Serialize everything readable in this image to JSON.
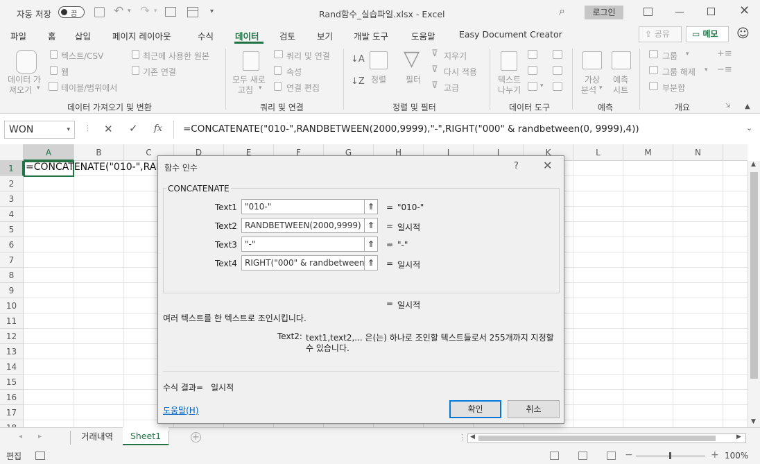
{
  "title_bar": {
    "autosave_label": "자동 저장",
    "autosave_state": "끔",
    "doc_title": "Rand함수_실습파일.xlsx  -  Excel",
    "login_label": "로그인"
  },
  "menu": {
    "tabs": [
      "파일",
      "홈",
      "삽입",
      "페이지 레이아웃",
      "수식",
      "데이터",
      "검토",
      "보기",
      "개발 도구",
      "도움말",
      "Easy Document Creator"
    ],
    "share_label": "공유",
    "memo_label": "메모"
  },
  "ribbon": {
    "get_data": {
      "big_label_1": "데이터 가",
      "big_label_2": "져오기",
      "text_csv": "텍스트/CSV",
      "web": "웹",
      "table_range": "테이블/범위에서",
      "recent_sources": "최근에 사용한 원본",
      "existing_conn": "기존 연결",
      "group": "데이터 가져오기 및 변환"
    },
    "queries": {
      "refresh_1": "모두 새로",
      "refresh_2": "고침",
      "queries_conn": "쿼리 및 연결",
      "properties": "속성",
      "edit_links": "연결 편집",
      "group": "쿼리 및 연결"
    },
    "sort_filter": {
      "sort": "정렬",
      "filter": "필터",
      "clear": "지우기",
      "reapply": "다시 적용",
      "advanced": "고급",
      "group": "정렬 및 필터"
    },
    "data_tools": {
      "text_col_1": "텍스트",
      "text_col_2": "나누기",
      "group": "데이터 도구"
    },
    "forecast": {
      "whatif_1": "가상",
      "whatif_2": "분석",
      "sheet_1": "예측",
      "sheet_2": "시트",
      "group": "예측"
    },
    "outline": {
      "group_btn": "그룹",
      "ungroup_btn": "그룹 해제",
      "subtotal": "부분합",
      "group": "개요"
    }
  },
  "formula_bar": {
    "name_box": "WON",
    "fx": "fx",
    "formula": "=CONCATENATE(\"010-\",RANDBETWEEN(2000,9999),\"-\",RIGHT(\"000\" & randbetween(0, 9999),4))"
  },
  "grid": {
    "columns": [
      "A",
      "B",
      "C",
      "D",
      "E",
      "F",
      "G",
      "H",
      "I",
      "J",
      "K",
      "L",
      "M",
      "N"
    ],
    "rows": [
      "1",
      "2",
      "3",
      "4",
      "5",
      "6",
      "7",
      "8",
      "9",
      "10",
      "11",
      "12",
      "13",
      "14",
      "15",
      "16",
      "17",
      "18"
    ],
    "cell_a1": "=CONCATENATE(\"010-\",RAN"
  },
  "sheets": {
    "tabs": [
      "거래내역",
      "Sheet1"
    ],
    "active": "Sheet1"
  },
  "status_bar": {
    "mode": "편집",
    "zoom": "100%"
  },
  "dialog": {
    "title": "함수 인수",
    "help": "?",
    "function_name": "CONCATENATE",
    "args": [
      {
        "label": "Text1",
        "value": "\"010-\"",
        "result": "\"010-\""
      },
      {
        "label": "Text2",
        "value": "RANDBETWEEN(2000,9999)",
        "result": "일시적"
      },
      {
        "label": "Text3",
        "value": "\"-\"",
        "result": "\"-\""
      },
      {
        "label": "Text4",
        "value": "RIGHT(\"000\" & randbetween(0",
        "result": "일시적"
      }
    ],
    "overall_result": "일시적",
    "description": "여러 텍스트를 한 텍스트로 조인시킵니다.",
    "arg_help_name": "Text2:",
    "arg_help_text_1": "text1,text2,... 은(는) 하나로 조인할 텍스트들로서 255개까지 지정할",
    "arg_help_text_2": "수 있습니다.",
    "formula_result_label": "수식 결과=",
    "formula_result_value": "일시적",
    "help_link": "도움말(H)",
    "ok": "확인",
    "cancel": "취소"
  }
}
